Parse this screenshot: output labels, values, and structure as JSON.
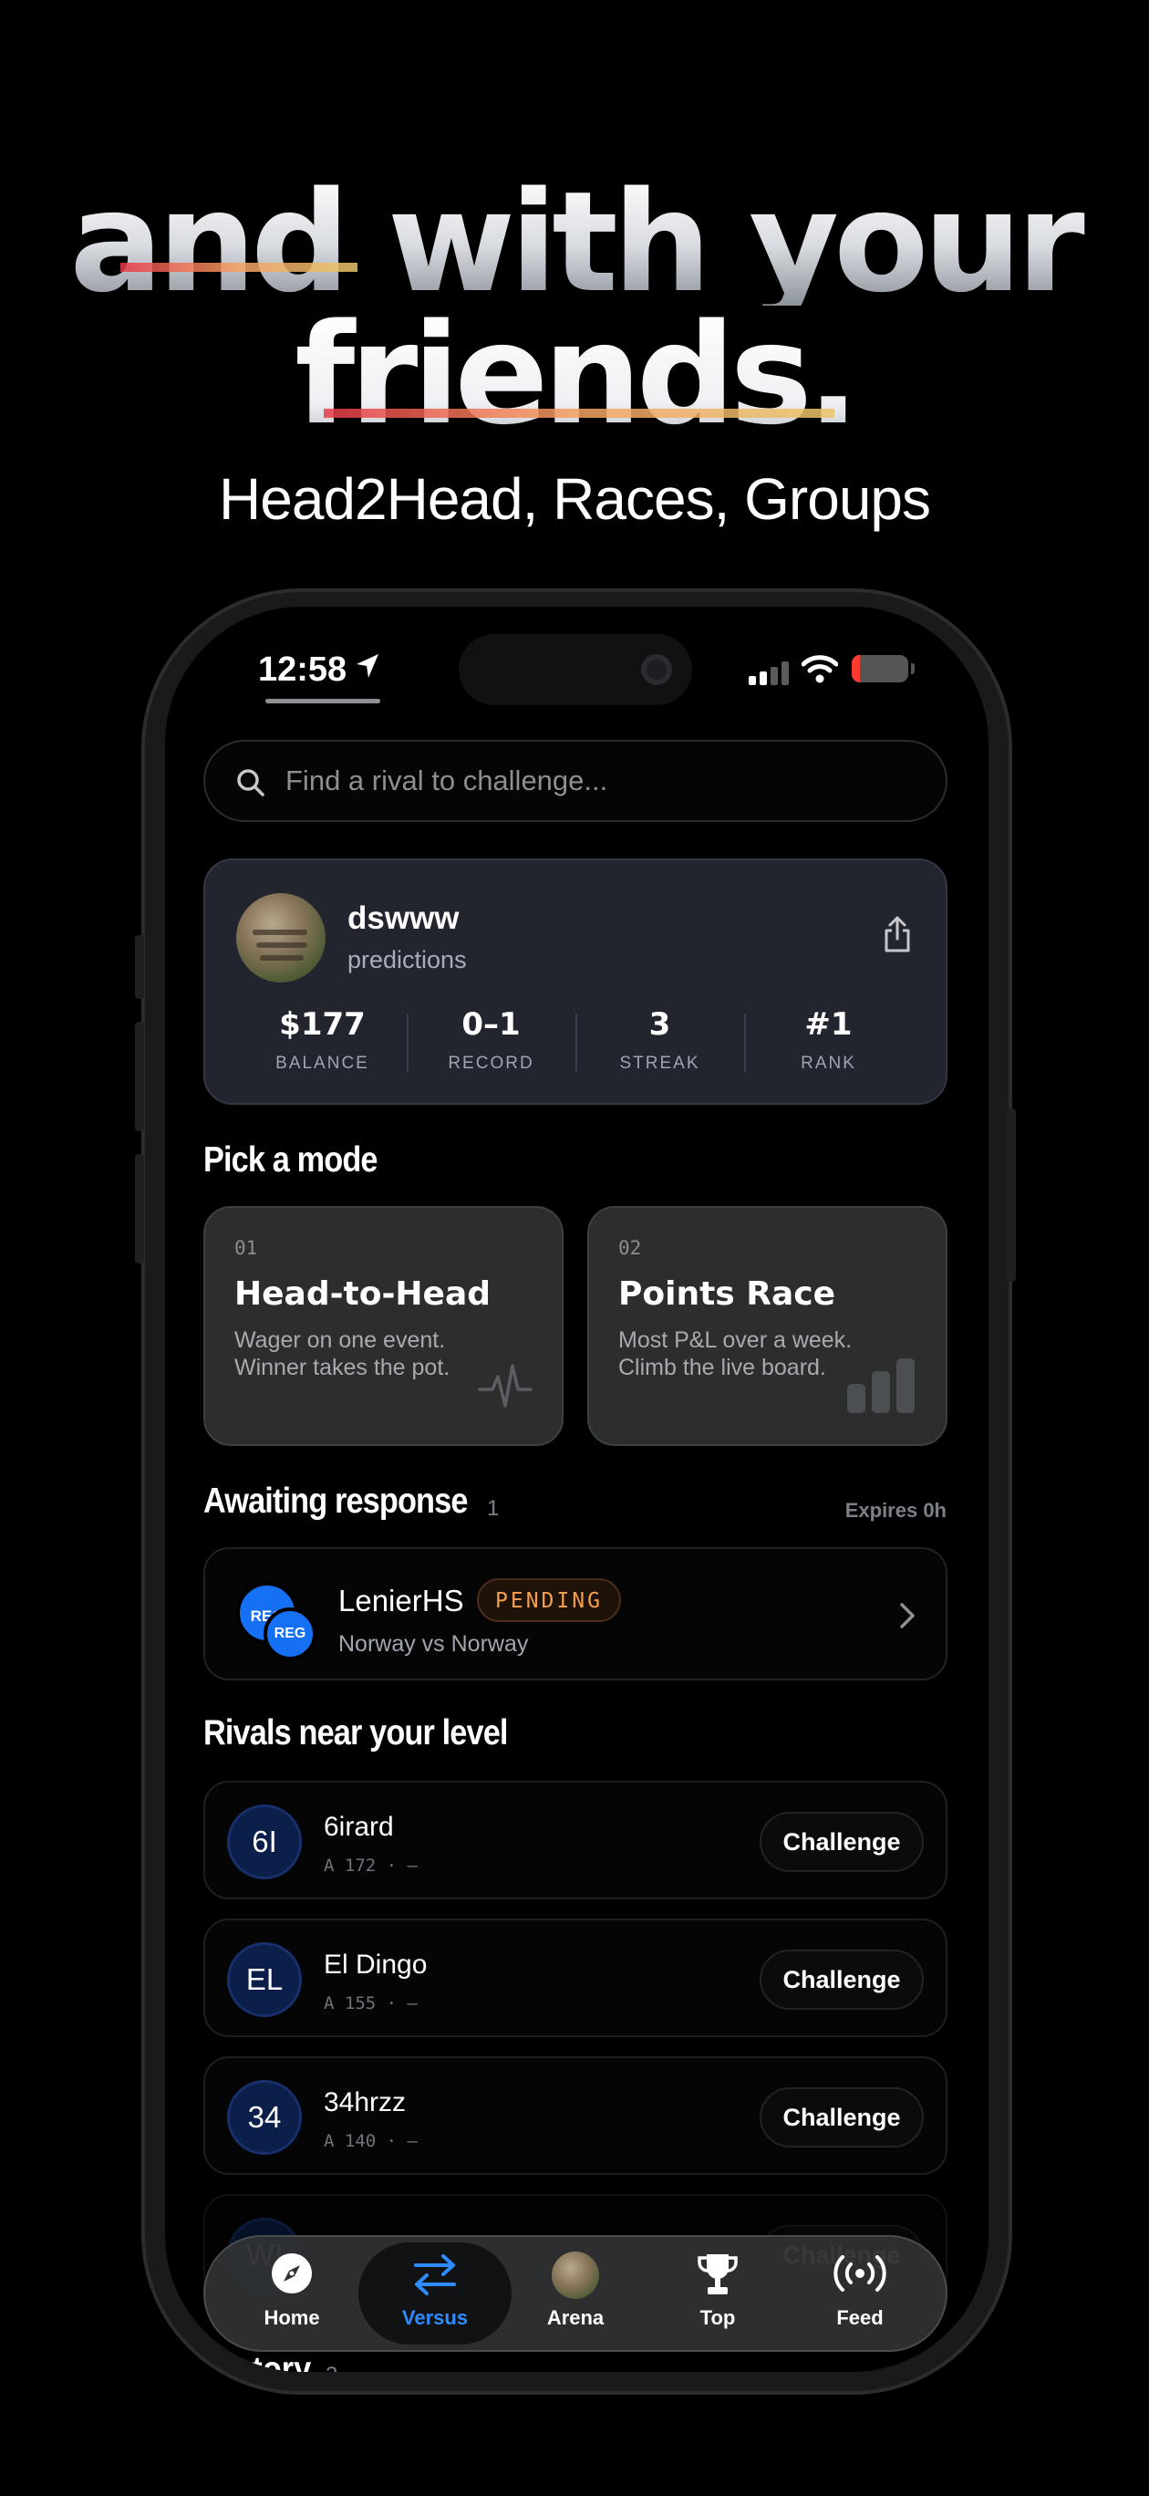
{
  "headline": {
    "line1": "and with your",
    "line2": "friends.",
    "subtitle": "Head2Head, Races, Groups"
  },
  "status_bar": {
    "time": "12:58",
    "battery_level": 0.15,
    "battery_color": "#ff3b30"
  },
  "search": {
    "placeholder": "Find a rival to challenge..."
  },
  "profile": {
    "username": "dswww",
    "subtitle": "predictions",
    "stats": [
      {
        "value": "$177",
        "label": "BALANCE"
      },
      {
        "value": "0–1",
        "label": "RECORD"
      },
      {
        "value": "3",
        "label": "STREAK"
      },
      {
        "value": "#1",
        "label": "RANK"
      }
    ]
  },
  "modes": {
    "title": "Pick a mode",
    "items": [
      {
        "num": "01",
        "title": "Head-to-Head",
        "desc_line1": "Wager on one event.",
        "desc_line2": "Winner takes the pot.",
        "icon": "pulse-icon"
      },
      {
        "num": "02",
        "title": "Points Race",
        "desc_line1": "Most P&L over a week.",
        "desc_line2": "Climb the live board.",
        "icon": "bar-chart-icon"
      }
    ]
  },
  "awaiting": {
    "title": "Awaiting response",
    "count": "1",
    "expires": "Expires 0h",
    "item": {
      "badge_back": "REG",
      "badge_front": "REG",
      "name": "LenierHS",
      "status": "PENDING",
      "match": "Norway vs Norway"
    }
  },
  "rivals": {
    "title": "Rivals near your level",
    "items": [
      {
        "initials": "6I",
        "name": "6irard",
        "meta": "A 172 · —",
        "action": "Challenge"
      },
      {
        "initials": "EL",
        "name": "El Dingo",
        "meta": "A 155 · —",
        "action": "Challenge"
      },
      {
        "initials": "34",
        "name": "34hrzz",
        "meta": "A 140 · —",
        "action": "Challenge"
      },
      {
        "initials": "WI",
        "name": "",
        "meta": "",
        "action": "Challenge"
      }
    ]
  },
  "history": {
    "title": "History",
    "count": "3"
  },
  "tabbar": {
    "items": [
      {
        "label": "Home",
        "icon": "compass-icon"
      },
      {
        "label": "Versus",
        "icon": "swap-arrows-icon",
        "active": true
      },
      {
        "label": "Arena",
        "icon": "avatar-icon"
      },
      {
        "label": "Top",
        "icon": "trophy-icon"
      },
      {
        "label": "Feed",
        "icon": "broadcast-icon"
      }
    ]
  },
  "colors": {
    "accent": "#2f8cff",
    "pending": "#f5a04a",
    "badge_blue": "#1670f4"
  }
}
